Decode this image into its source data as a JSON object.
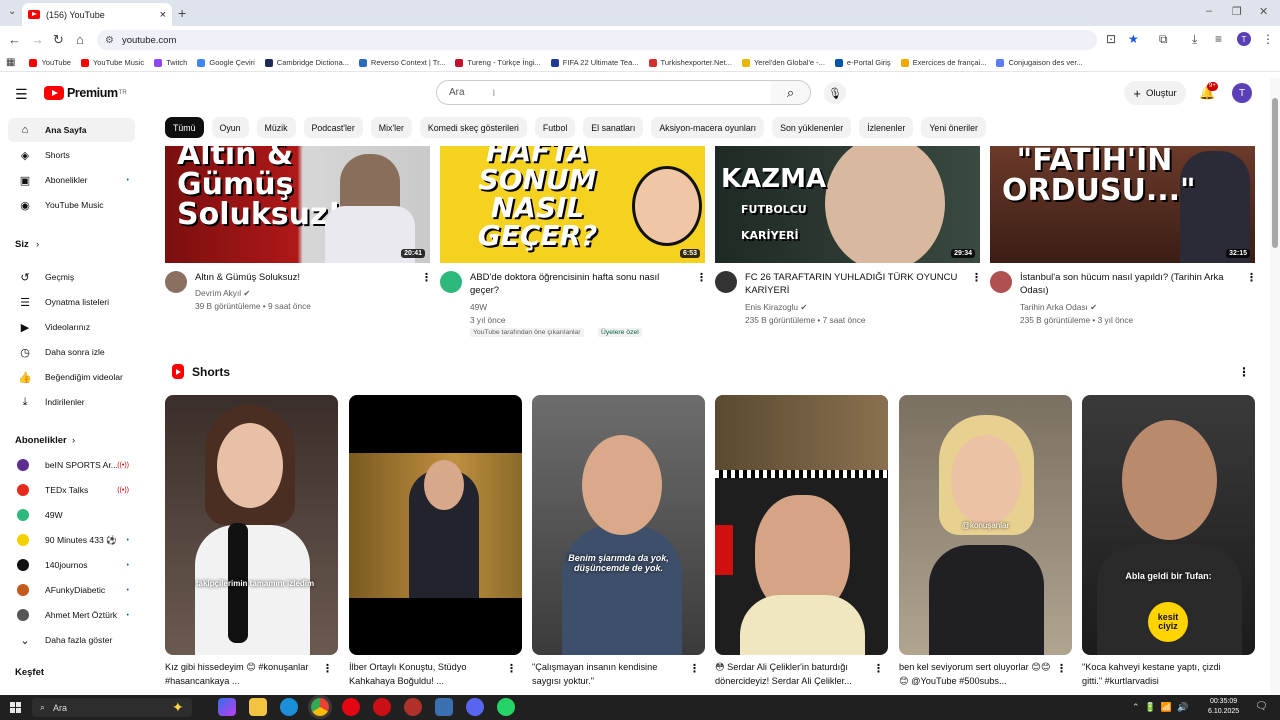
{
  "browser": {
    "tab_title": "(156) YouTube",
    "url": "youtube.com",
    "bookmarks": [
      {
        "label": "YouTube",
        "color": "#ff0000"
      },
      {
        "label": "YouTube Music",
        "color": "#ff0000"
      },
      {
        "label": "Twitch",
        "color": "#9146ff"
      },
      {
        "label": "Google Çeviri",
        "color": "#4285f4"
      },
      {
        "label": "Cambridge Dictiona...",
        "color": "#1d2a57"
      },
      {
        "label": "Reverso Context | Tr...",
        "color": "#2a6ebb"
      },
      {
        "label": "Tureng - Türkçe İngi...",
        "color": "#c8102e"
      },
      {
        "label": "FIFA 22 Ultimate Tea...",
        "color": "#1f3a93"
      },
      {
        "label": "Turkishexporter.Net...",
        "color": "#d32f2f"
      },
      {
        "label": "Yerel'den Global'e -...",
        "color": "#e6b800"
      },
      {
        "label": "e-Portal Giriş",
        "color": "#0055aa"
      },
      {
        "label": "Exercices de françai...",
        "color": "#f2a900"
      },
      {
        "label": "Conjugaison des ver...",
        "color": "#5c7cfa"
      }
    ],
    "profile_initial": "T"
  },
  "youtube": {
    "logo_text": "Premium",
    "logo_country": "TR",
    "search_placeholder": "Ara",
    "create_label": "Oluştur",
    "notification_count": "9+",
    "avatar_initial": "T"
  },
  "sidebar": {
    "main": [
      {
        "label": "Ana Sayfa",
        "icon": "home-icon",
        "glyph": "⌂",
        "active": true
      },
      {
        "label": "Shorts",
        "icon": "shorts-icon",
        "glyph": "◈"
      },
      {
        "label": "Abonelikler",
        "icon": "subscriptions-icon",
        "glyph": "▣",
        "dot": "•"
      },
      {
        "label": "YouTube Music",
        "icon": "youtube-music-icon",
        "glyph": "◉"
      }
    ],
    "you_header": "Siz",
    "you": [
      {
        "label": "Geçmiş",
        "icon": "history-icon",
        "glyph": "↺"
      },
      {
        "label": "Oynatma listeleri",
        "icon": "playlists-icon",
        "glyph": "☰"
      },
      {
        "label": "Videolarınız",
        "icon": "your-videos-icon",
        "glyph": "▶"
      },
      {
        "label": "Daha sonra izle",
        "icon": "watch-later-icon",
        "glyph": "◷"
      },
      {
        "label": "Beğendiğim videolar",
        "icon": "liked-icon",
        "glyph": "👍"
      },
      {
        "label": "İndirilenler",
        "icon": "downloads-icon",
        "glyph": "⤓"
      }
    ],
    "subs_header": "Abonelikler",
    "subs": [
      {
        "label": "beIN SPORTS Ar...",
        "color": "#5b2d8e",
        "live": "((•))"
      },
      {
        "label": "TEDx Talks",
        "color": "#e62b1e",
        "live": "((•))"
      },
      {
        "label": "49W",
        "color": "#2db87c"
      },
      {
        "label": "90 Minutes 433 ⚽",
        "color": "#f5d000",
        "dot": "•"
      },
      {
        "label": "140journos",
        "color": "#111111",
        "dot": "•"
      },
      {
        "label": "AFunkyDiabetic",
        "color": "#c45a1c",
        "dot": "•"
      },
      {
        "label": "Ahmet Mert Öztürk",
        "color": "#555555",
        "dot": "•"
      }
    ],
    "show_more": "Daha fazla göster",
    "explore_header": "Keşfet"
  },
  "chips": [
    "Tümü",
    "Oyun",
    "Müzik",
    "Podcast'ler",
    "Mix'ler",
    "Komedi skeç gösterileri",
    "Futbol",
    "El sanatları",
    "Aksiyon-macera oyunları",
    "Son yüklenenler",
    "İzlenenler",
    "Yeni öneriler"
  ],
  "videos": [
    {
      "thumb_text": "Altın & Gümüş Soluksuz!",
      "duration": "20:41",
      "title": "Altın & Gümüş Soluksuz!",
      "channel": "Devrim Akyıl ✔",
      "meta": "39 B görüntüleme • 9 saat önce"
    },
    {
      "thumb_text": "HAFTA SONUM NASIL GEÇER?",
      "duration": "6:53",
      "title": "ABD'de doktora öğrencisinin hafta sonu nasıl geçer?",
      "channel": "49W",
      "meta": "3 yıl önce",
      "tag1": "YouTube tarafından öne çıkarılanlar",
      "tag2": "Üyelere özel"
    },
    {
      "thumb_text": "KAZMA FUTBOLCU KARİYERİ",
      "duration": "29:34",
      "title": "FC 26 TARAFTARIN YUHLADIĞI TÜRK OYUNCU KARİYERİ",
      "channel": "Enis Kirazoglu ✔",
      "meta": "235 B görüntüleme • 7 saat önce"
    },
    {
      "thumb_text": "\"FATİH'İN ORDUSU...\"",
      "duration": "32:15",
      "title": "İstanbul'a son hücum nasıl yapıldı? (Tarihin Arka Odası)",
      "channel": "Tarihin Arka Odası ✔",
      "meta": "235 B görüntüleme • 3 yıl önce"
    }
  ],
  "shorts": {
    "header": "Shorts",
    "items": [
      {
        "title": "Kız gibi hissedeyim 😊 #konuşanlar #hasancankaya ...",
        "caption": "takipçilerimin tamamını izledim"
      },
      {
        "title": "İlber Ortaylı Konuştu, Stüdyo Kahkahaya Boğuldu! ...",
        "caption": ""
      },
      {
        "title": "\"Çalışmayan insanın kendisine saygısı yoktur.\"",
        "caption": "Benim şiarımda da yok, düşüncemde de yok."
      },
      {
        "title": "😳 Serdar Ali Çelikler'in baturdığı dönercideyiz! Serdar Ali Çelikler...",
        "caption": ""
      },
      {
        "title": "ben kel seviyorum sert oluyorlar 😊😊😊 @YouTube #500subs...",
        "caption": "@konuşanlar"
      },
      {
        "title": "\"Koca kahveyi kestane yaptı, çizdi gitti.\" #kurtlarvadisi",
        "caption": "Abla geldi bir Tufan:"
      }
    ]
  },
  "taskbar": {
    "search": "Ara",
    "time": "00:35:09",
    "date": "6.10.2025"
  }
}
